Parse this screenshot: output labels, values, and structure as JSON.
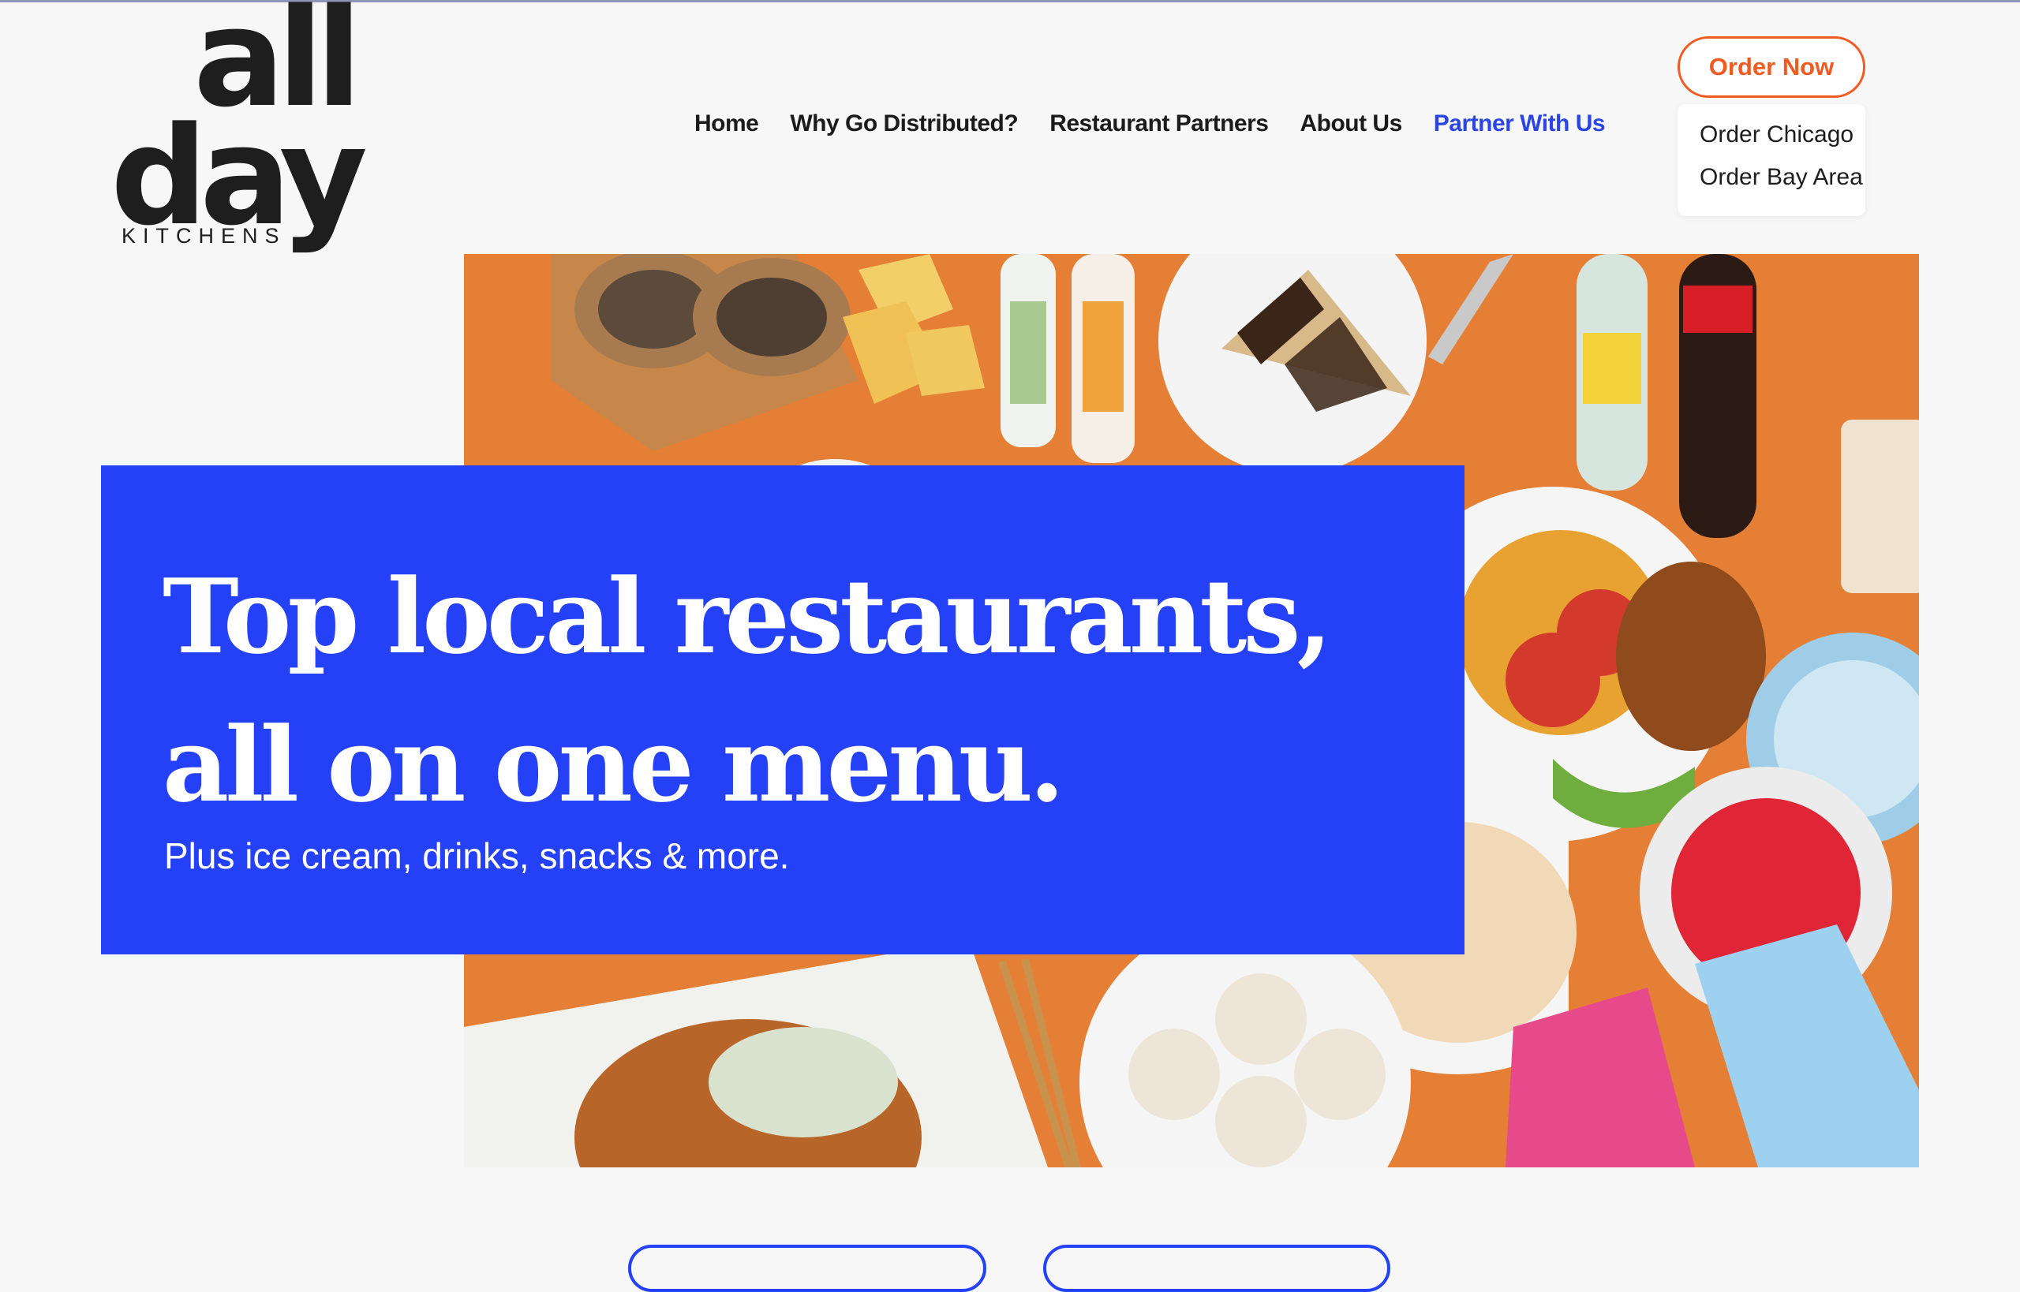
{
  "logo": {
    "line1": "all",
    "line2": "day",
    "line3": "KITCHENS"
  },
  "nav": {
    "home": "Home",
    "why": "Why Go Distributed?",
    "partners": "Restaurant Partners",
    "about": "About Us",
    "partner_with_us": "Partner With Us"
  },
  "order": {
    "button_label": "Order Now",
    "menu": [
      "Order Chicago",
      "Order Bay Area"
    ]
  },
  "hero": {
    "headline": "Top local restaurants, all on one menu.",
    "subhead": "Plus ice cream, drinks, snacks & more."
  },
  "colors": {
    "brand_blue": "#2541f7",
    "accent_orange": "#f05b22",
    "hero_bg": "#e57f35",
    "partner_link": "#2b44e6"
  }
}
